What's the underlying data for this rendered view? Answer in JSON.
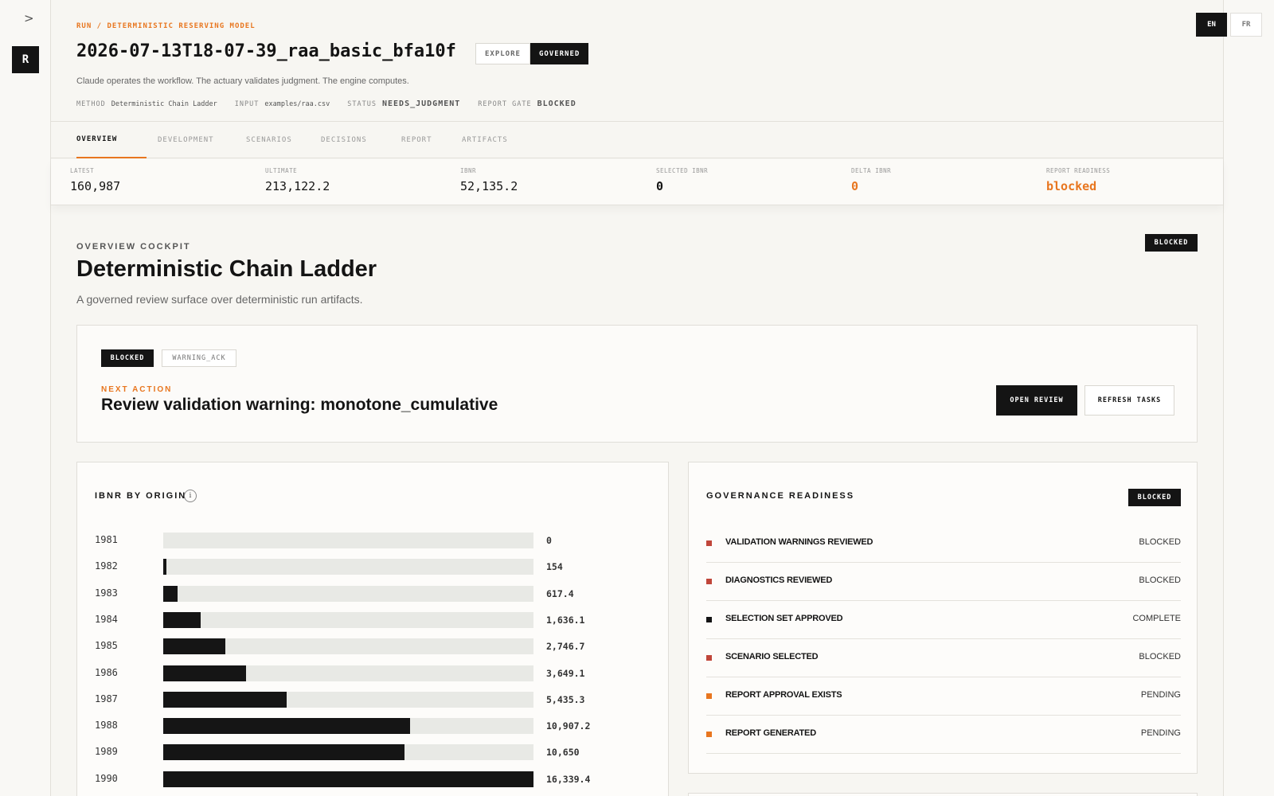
{
  "nav": {
    "expand": ">",
    "logo": "R"
  },
  "lang": {
    "en": "EN",
    "fr": "FR"
  },
  "header": {
    "breadcrumb": "RUN / DETERMINISTIC RESERVING MODEL",
    "run_id": "2026-07-13T18-07-39_raa_basic_bfa10f",
    "mode_explore": "EXPLORE",
    "mode_governed": "GOVERNED",
    "tagline": "Claude operates the workflow. The actuary validates judgment. The engine computes.",
    "meta": {
      "method_label": "METHOD",
      "method_value": "Deterministic Chain Ladder",
      "input_label": "INPUT",
      "input_value": "examples/raa.csv",
      "status_label": "STATUS",
      "status_value": "NEEDS_JUDGMENT",
      "gate_label": "REPORT GATE",
      "gate_value": "BLOCKED"
    }
  },
  "tabs": [
    "OVERVIEW",
    "DEVELOPMENT",
    "SCENARIOS",
    "DECISIONS",
    "REPORT",
    "ARTIFACTS"
  ],
  "kpis": [
    {
      "label": "LATEST",
      "value": "160,987"
    },
    {
      "label": "ULTIMATE",
      "value": "213,122.2"
    },
    {
      "label": "IBNR",
      "value": "52,135.2"
    },
    {
      "label": "SELECTED IBNR",
      "value": "0"
    },
    {
      "label": "DELTA IBNR",
      "value": "0"
    },
    {
      "label": "REPORT READINESS",
      "value": "blocked"
    }
  ],
  "overview": {
    "label": "OVERVIEW COCKPIT",
    "title": "Deterministic Chain Ladder",
    "subtitle": "A governed review surface over deterministic run artifacts.",
    "badge": "BLOCKED"
  },
  "next_action": {
    "badge_blocked": "BLOCKED",
    "badge_warning": "WARNING_ACK",
    "label": "NEXT ACTION",
    "title": "Review validation warning: monotone_cumulative",
    "open_review": "OPEN REVIEW",
    "refresh_tasks": "REFRESH TASKS"
  },
  "chart_data": {
    "type": "bar",
    "title": "IBNR BY ORIGIN",
    "categories": [
      "1981",
      "1982",
      "1983",
      "1984",
      "1985",
      "1986",
      "1987",
      "1988",
      "1989",
      "1990"
    ],
    "values": [
      0,
      154,
      617.4,
      1636.1,
      2746.7,
      3649.1,
      5435.3,
      10907.2,
      10650,
      16339.4
    ],
    "labels": [
      "0",
      "154",
      "617.4",
      "1,636.1",
      "2,746.7",
      "3,649.1",
      "5,435.3",
      "10,907.2",
      "10,650",
      "16,339.4"
    ],
    "xlim": [
      0,
      16339.4
    ],
    "orientation": "horizontal",
    "colors": {
      "bar": "#151515",
      "track": "#e8e9e5"
    }
  },
  "governance": {
    "title": "GOVERNANCE READINESS",
    "badge": "BLOCKED",
    "items": [
      {
        "label": "VALIDATION WARNINGS REVIEWED",
        "status": "BLOCKED",
        "color": "#c0463a"
      },
      {
        "label": "DIAGNOSTICS REVIEWED",
        "status": "BLOCKED",
        "color": "#c0463a"
      },
      {
        "label": "SELECTION SET APPROVED",
        "status": "COMPLETE",
        "color": "#141414"
      },
      {
        "label": "SCENARIO SELECTED",
        "status": "BLOCKED",
        "color": "#c0463a"
      },
      {
        "label": "REPORT APPROVAL EXISTS",
        "status": "PENDING",
        "color": "#e8761f"
      },
      {
        "label": "REPORT GENERATED",
        "status": "PENDING",
        "color": "#e8761f"
      }
    ]
  }
}
